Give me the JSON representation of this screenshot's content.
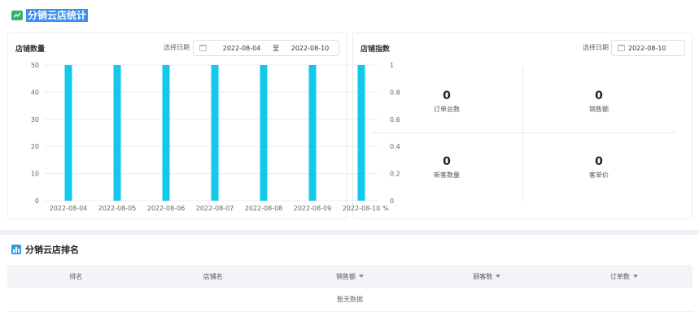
{
  "header": {
    "title": "分销云店统计"
  },
  "stores_card": {
    "title": "店铺数量",
    "date_label": "选择日期",
    "start_date": "2022-08-04",
    "separator": "至",
    "end_date": "2022-08-10"
  },
  "index_card": {
    "title": "店铺指数",
    "date_label": "选择日期",
    "date": "2022-08-10",
    "metrics": [
      {
        "value": "0",
        "label": "订单总数"
      },
      {
        "value": "0",
        "label": "销售额"
      },
      {
        "value": "0",
        "label": "新客数量"
      },
      {
        "value": "0",
        "label": "客单价"
      }
    ]
  },
  "chart_data": {
    "type": "bar",
    "categories": [
      "2022-08-04",
      "2022-08-05",
      "2022-08-06",
      "2022-08-07",
      "2022-08-08",
      "2022-08-09",
      "2022-08-10"
    ],
    "series": [
      {
        "values": [
          50,
          50,
          50,
          50,
          50,
          50,
          50
        ]
      }
    ],
    "ylim": [
      0,
      50
    ],
    "yticks": [
      "0",
      "10",
      "20",
      "30",
      "40",
      "50"
    ],
    "y2lim": [
      0,
      1
    ],
    "y2ticks": [
      "0",
      "0.2",
      "0.4",
      "0.6",
      "0.8",
      "1"
    ],
    "y2unit": "%",
    "grid": true,
    "bar_color": "#13c8ea"
  },
  "ranking": {
    "title": "分销云店排名",
    "columns": [
      {
        "label": "排名",
        "sortable": false
      },
      {
        "label": "店铺名",
        "sortable": false
      },
      {
        "label": "销售额",
        "sortable": true
      },
      {
        "label": "顾客数",
        "sortable": true
      },
      {
        "label": "订单数",
        "sortable": true
      }
    ],
    "empty_text": "暂无数据"
  }
}
